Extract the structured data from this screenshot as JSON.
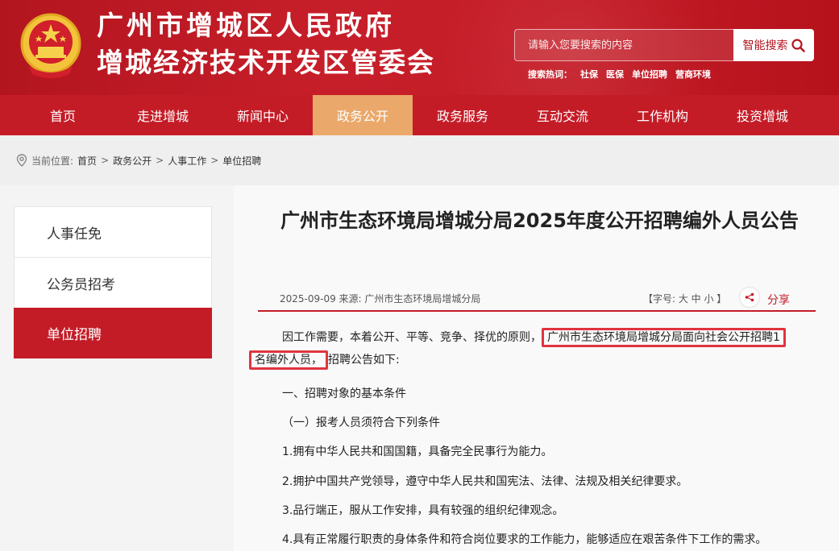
{
  "header": {
    "title_line1": "广州市增城区人民政府",
    "title_line2": "增城经济技术开发区管委会",
    "search_placeholder": "请输入您要搜索的内容",
    "search_button": "智能搜索",
    "hot_label": "搜索热词：",
    "hot_words": [
      "社保",
      "医保",
      "单位招聘",
      "营商环境"
    ]
  },
  "nav": [
    "首页",
    "走进增城",
    "新闻中心",
    "政务公开",
    "政务服务",
    "互动交流",
    "工作机构",
    "投资增城"
  ],
  "breadcrumb": {
    "label": "当前位置:",
    "items": [
      "首页",
      "政务公开",
      "人事工作",
      "单位招聘"
    ]
  },
  "sidebar": [
    "人事任免",
    "公务员招考",
    "单位招聘"
  ],
  "article": {
    "title": "广州市生态环境局增城分局2025年度公开招聘编外人员公告",
    "meta": "2025-09-09 来源: 广州市生态环境局增城分局",
    "font_size": "【字号: 大 中 小 】",
    "share": "分享",
    "para1_a": "因工作需要，本着公开、平等、竞争、择优的原则，",
    "para1_hl1": "广州市生态环境局增城分局面向社会公开招聘1",
    "para1_hl2": "名编外人员，",
    "para1_b": "招聘公告如下:",
    "line1": "一、招聘对象的基本条件",
    "line2": "（一）报考人员须符合下列条件",
    "line3": "1.拥有中华人民共和国国籍，具备完全民事行为能力。",
    "line4": "2.拥护中国共产党领导，遵守中华人民共和国宪法、法律、法规及相关纪律要求。",
    "line5": "3.品行端正，服从工作安排，具有较强的组织纪律观念。",
    "line6": "4.具有正常履行职责的身体条件和符合岗位要求的工作能力，能够适应在艰苦条件下工作的需求。"
  },
  "colors": {
    "brand_red": "#c41c27",
    "active_nav": "#eaa86a",
    "highlight": "#e0343f"
  }
}
